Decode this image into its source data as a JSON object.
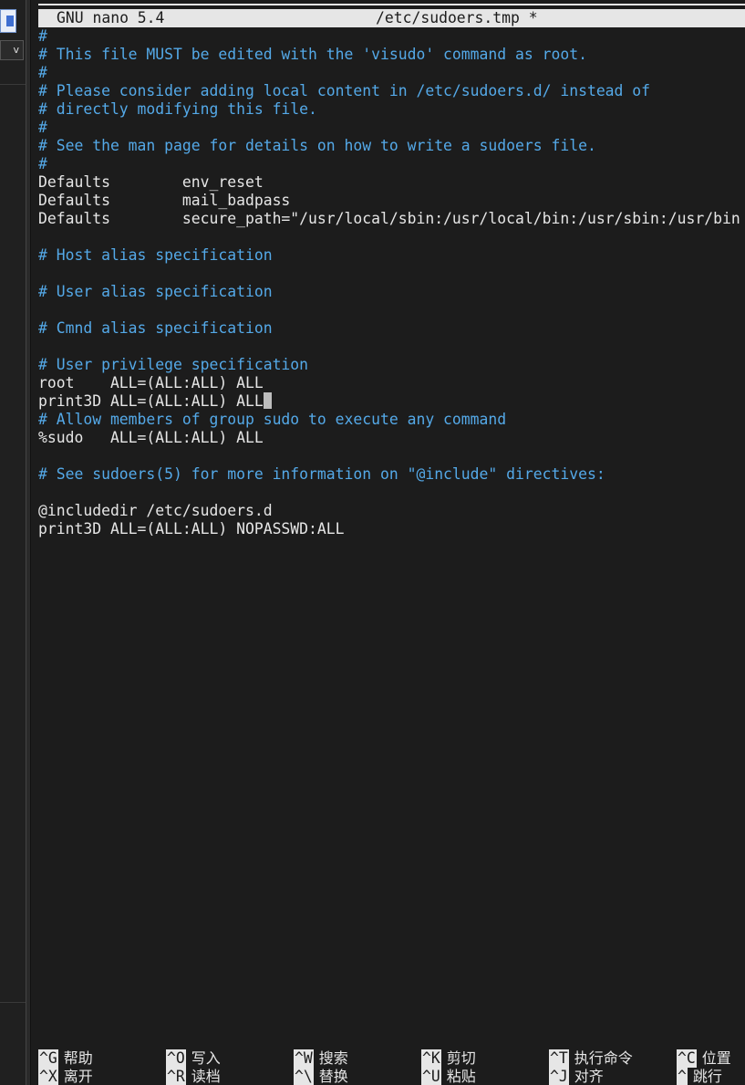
{
  "editor": {
    "app_name": "GNU nano 5.4",
    "file_name": "/etc/sudoers.tmp *"
  },
  "content_lines": [
    {
      "text": "#",
      "kind": "comment"
    },
    {
      "text": "# This file MUST be edited with the 'visudo' command as root.",
      "kind": "comment"
    },
    {
      "text": "#",
      "kind": "comment"
    },
    {
      "text": "# Please consider adding local content in /etc/sudoers.d/ instead of",
      "kind": "comment"
    },
    {
      "text": "# directly modifying this file.",
      "kind": "comment"
    },
    {
      "text": "#",
      "kind": "comment"
    },
    {
      "text": "# See the man page for details on how to write a sudoers file.",
      "kind": "comment"
    },
    {
      "text": "#",
      "kind": "comment"
    },
    {
      "text": "Defaults        env_reset",
      "kind": "code"
    },
    {
      "text": "Defaults        mail_badpass",
      "kind": "code"
    },
    {
      "text": "Defaults        secure_path=\"/usr/local/sbin:/usr/local/bin:/usr/sbin:/usr/bin",
      "kind": "code"
    },
    {
      "text": "",
      "kind": "code"
    },
    {
      "text": "# Host alias specification",
      "kind": "comment"
    },
    {
      "text": "",
      "kind": "code"
    },
    {
      "text": "# User alias specification",
      "kind": "comment"
    },
    {
      "text": "",
      "kind": "code"
    },
    {
      "text": "# Cmnd alias specification",
      "kind": "comment"
    },
    {
      "text": "",
      "kind": "code"
    },
    {
      "text": "# User privilege specification",
      "kind": "comment"
    },
    {
      "text": "root    ALL=(ALL:ALL) ALL",
      "kind": "code"
    },
    {
      "text": "print3D ALL=(ALL:ALL) ALL",
      "kind": "code",
      "cursor": true
    },
    {
      "text": "# Allow members of group sudo to execute any command",
      "kind": "comment"
    },
    {
      "text": "%sudo   ALL=(ALL:ALL) ALL",
      "kind": "code"
    },
    {
      "text": "",
      "kind": "code"
    },
    {
      "text": "# See sudoers(5) for more information on \"@include\" directives:",
      "kind": "comment"
    },
    {
      "text": "",
      "kind": "code"
    },
    {
      "text": "@includedir /etc/sudoers.d",
      "kind": "code"
    },
    {
      "text": "print3D ALL=(ALL:ALL) NOPASSWD:ALL",
      "kind": "code"
    }
  ],
  "shortcuts_row1": [
    {
      "key": "^G",
      "label": "帮助"
    },
    {
      "key": "^O",
      "label": "写入"
    },
    {
      "key": "^W",
      "label": "搜索"
    },
    {
      "key": "^K",
      "label": "剪切"
    },
    {
      "key": "^T",
      "label": "执行命令"
    },
    {
      "key": "^C",
      "label": "位置"
    }
  ],
  "shortcuts_row2": [
    {
      "key": "^X",
      "label": "离开"
    },
    {
      "key": "^R",
      "label": "读档"
    },
    {
      "key": "^\\",
      "label": "替换"
    },
    {
      "key": "^U",
      "label": "粘贴"
    },
    {
      "key": "^J",
      "label": "对齐"
    },
    {
      "key": "^",
      "label": "跳行"
    }
  ],
  "colors": {
    "background": "#1c1c1c",
    "text": "#e6e6e6",
    "comment": "#54a9e8",
    "titlebar": "#e6e6e6"
  },
  "icons": [
    "window-icon",
    "chevron-down-icon"
  ]
}
